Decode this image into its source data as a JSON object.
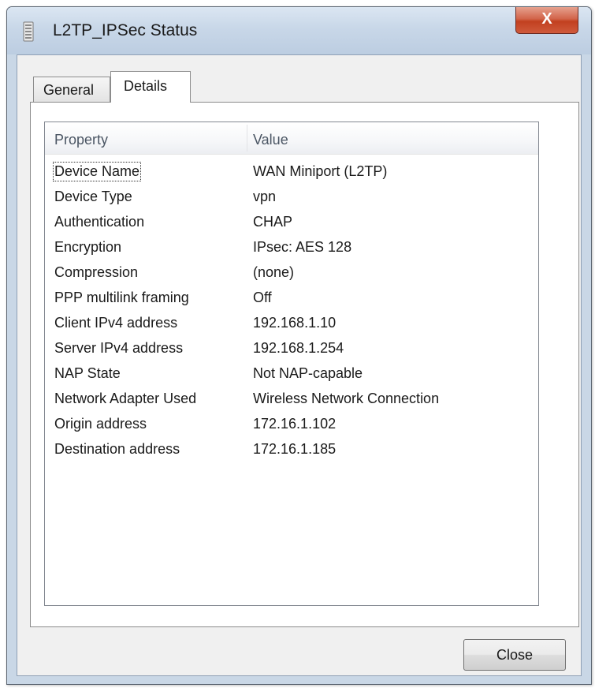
{
  "window": {
    "title": "L2TP_IPSec Status",
    "title_icon": "network-status-icon",
    "close_glyph": "X"
  },
  "tabs": [
    {
      "label": "General",
      "active": false
    },
    {
      "label": "Details",
      "active": true
    }
  ],
  "details": {
    "columns": [
      "Property",
      "Value"
    ],
    "rows": [
      {
        "property": "Device Name",
        "value": "WAN Miniport (L2TP)"
      },
      {
        "property": "Device Type",
        "value": "vpn"
      },
      {
        "property": "Authentication",
        "value": "CHAP"
      },
      {
        "property": "Encryption",
        "value": "IPsec: AES 128"
      },
      {
        "property": "Compression",
        "value": "(none)"
      },
      {
        "property": "PPP multilink framing",
        "value": "Off"
      },
      {
        "property": "Client IPv4 address",
        "value": "192.168.1.10"
      },
      {
        "property": "Server IPv4 address",
        "value": "192.168.1.254"
      },
      {
        "property": "NAP State",
        "value": "Not NAP-capable"
      },
      {
        "property": "Network Adapter Used",
        "value": "Wireless Network Connection"
      },
      {
        "property": "Origin address",
        "value": "172.16.1.102"
      },
      {
        "property": "Destination address",
        "value": "172.16.1.185"
      }
    ]
  },
  "buttons": {
    "close_label": "Close"
  }
}
